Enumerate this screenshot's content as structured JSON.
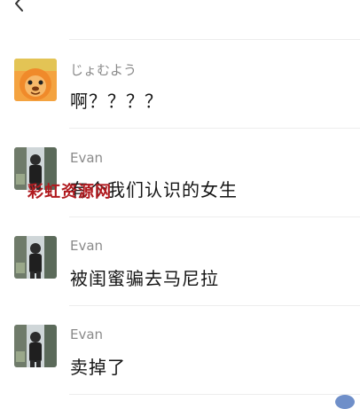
{
  "header": {
    "back_icon": "chevron-left-icon"
  },
  "messages": [
    {
      "sender": "じょむよう",
      "text": "啊？？？？",
      "avatar": "cartoon-lion-avatar"
    },
    {
      "sender": "Evan",
      "text": "有个我们认识的女生",
      "avatar": "man-by-window-avatar"
    },
    {
      "sender": "Evan",
      "text": "被闺蜜骗去马尼拉",
      "avatar": "man-by-window-avatar"
    },
    {
      "sender": "Evan",
      "text": "卖掉了",
      "avatar": "man-by-window-avatar"
    }
  ],
  "watermark": "彩虹资源网",
  "colors": {
    "sender_name": "#8a8a8a",
    "message_text": "#151515",
    "divider": "#ededed",
    "watermark": "#b0191e"
  }
}
